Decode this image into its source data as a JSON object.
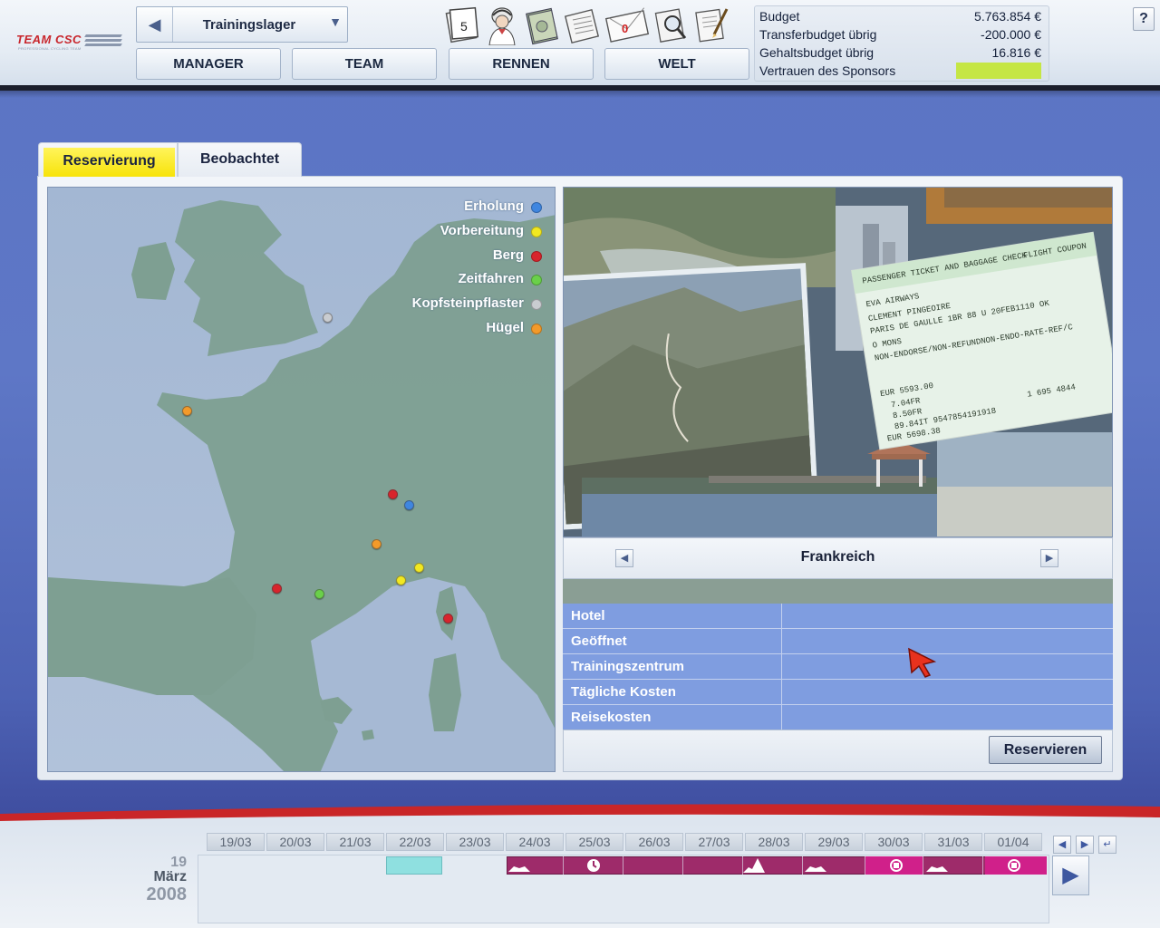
{
  "logo": {
    "brand": "TEAM CSC",
    "tagline": "PROFESSIONAL CYCLING TEAM"
  },
  "header": {
    "screen_title": "Trainingslager",
    "nav": [
      "MANAGER",
      "TEAM",
      "RENNEN",
      "WELT"
    ],
    "tool_icons": [
      "calendar-icon",
      "cyclist-icon",
      "money-stack-icon",
      "newspaper-icon",
      "mail-icon",
      "scout-magnifier-icon",
      "notes-icon"
    ],
    "calendar_icon_day": "5",
    "mail_count": "0",
    "help": "?"
  },
  "budget": {
    "rows": [
      {
        "label": "Budget",
        "value": "5.763.854 €"
      },
      {
        "label": "Transferbudget übrig",
        "value": "-200.000 €"
      },
      {
        "label": "Gehaltsbudget übrig",
        "value": "16.816 €"
      },
      {
        "label": "Vertrauen des Sponsors",
        "value": ""
      }
    ],
    "sponsor_confidence_color": "#c5e644"
  },
  "tabs": [
    {
      "label": "Reservierung",
      "active": true
    },
    {
      "label": "Beobachtet",
      "active": false
    }
  ],
  "map": {
    "legend": [
      {
        "label": "Erholung",
        "color": "#3f86e0"
      },
      {
        "label": "Vorbereitung",
        "color": "#f2e820"
      },
      {
        "label": "Berg",
        "color": "#d8242c"
      },
      {
        "label": "Zeitfahren",
        "color": "#6ad04a"
      },
      {
        "label": "Kopfsteinpflaster",
        "color": "#c9ccd0"
      },
      {
        "label": "Hügel",
        "color": "#f39a2a"
      }
    ]
  },
  "details": {
    "country": "Frankreich",
    "rows": [
      {
        "label": "Hotel",
        "value": ""
      },
      {
        "label": "Geöffnet",
        "value": ""
      },
      {
        "label": "Trainingszentrum",
        "value": ""
      },
      {
        "label": "Tägliche Kosten",
        "value": ""
      },
      {
        "label": "Reisekosten",
        "value": ""
      }
    ],
    "reserve_button": "Reservieren"
  },
  "calendar": {
    "dates": [
      "19/03",
      "20/03",
      "21/03",
      "22/03",
      "23/03",
      "24/03",
      "25/03",
      "26/03",
      "27/03",
      "28/03",
      "29/03",
      "30/03",
      "31/03",
      "01/04"
    ],
    "current_day": "19",
    "current_month": "März",
    "current_year": "2008"
  }
}
